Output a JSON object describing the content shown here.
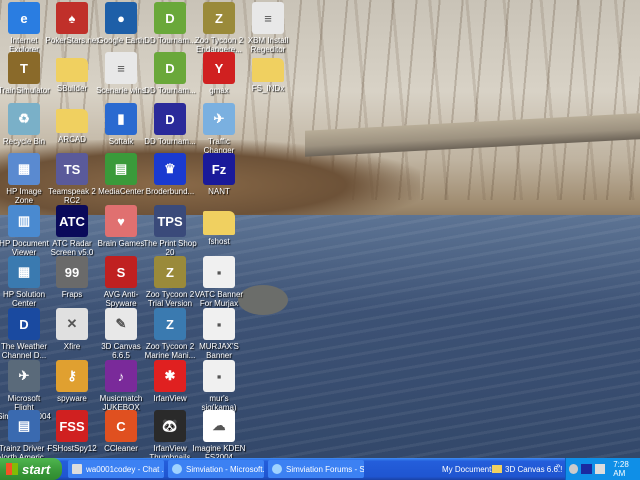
{
  "desktop": {
    "rows": [
      [
        {
          "label": "Internet Explorer",
          "icon": "internet-explorer-icon",
          "color": "#2a7de1",
          "glyph": "e"
        },
        {
          "label": "PokerStars.net",
          "icon": "pokerstars-icon",
          "color": "#c0302a",
          "glyph": "♠"
        },
        {
          "label": "Google Earth",
          "icon": "google-earth-icon",
          "color": "#1e5fa8",
          "glyph": "●"
        },
        {
          "label": "DD Tournam...",
          "icon": "dd-tournament-icon",
          "color": "#6aa83a",
          "glyph": "D"
        },
        {
          "label": "Zoo Tycoon 2 Endangere...",
          "icon": "zoo-tycoon-icon",
          "color": "#9a8a3a",
          "glyph": "Z"
        },
        {
          "label": "XBM Install Regeditor",
          "icon": "document-icon",
          "color": "#e8e8e8",
          "glyph": "≡"
        }
      ],
      [
        {
          "label": "TrainSimulator",
          "icon": "train-simulator-icon",
          "color": "#8a6a2a",
          "glyph": "T"
        },
        {
          "label": "SBuilder",
          "icon": "folder-icon",
          "color": "#f0d060",
          "glyph": ""
        },
        {
          "label": "Scenarie wins",
          "icon": "document-icon",
          "color": "#e8e8e8",
          "glyph": "≡"
        },
        {
          "label": "DD Tournam...",
          "icon": "dd-tournament-icon",
          "color": "#6aa83a",
          "glyph": "D"
        },
        {
          "label": "gmax",
          "icon": "gmax-icon",
          "color": "#d02020",
          "glyph": "Y"
        },
        {
          "label": "FS_INDx",
          "icon": "folder-icon",
          "color": "#f0d060",
          "glyph": ""
        }
      ],
      [
        {
          "label": "Recycle Bin",
          "icon": "recycle-bin-icon",
          "color": "#7ab0c8",
          "glyph": "♻"
        },
        {
          "label": "ARCAD",
          "icon": "folder-icon",
          "color": "#f0d060",
          "glyph": ""
        },
        {
          "label": "Softalk",
          "icon": "softalk-icon",
          "color": "#2a6ad0",
          "glyph": "▮"
        },
        {
          "label": "DD Tournam...",
          "icon": "dd-tournament-icon",
          "color": "#2a2a9a",
          "glyph": "D"
        },
        {
          "label": "Traffic Changer",
          "icon": "traffic-changer-icon",
          "color": "#7ab0e0",
          "glyph": "✈"
        }
      ],
      [
        {
          "label": "HP Image Zone",
          "icon": "hp-image-zone-icon",
          "color": "#5a8ad0",
          "glyph": "▦"
        },
        {
          "label": "Teamspeak 2 RC2",
          "icon": "teamspeak-icon",
          "color": "#5a5a9a",
          "glyph": "TS"
        },
        {
          "label": "MediaCenter",
          "icon": "media-center-icon",
          "color": "#3a9a3a",
          "glyph": "▤"
        },
        {
          "label": "Broderbund...",
          "icon": "broderbund-icon",
          "color": "#1a3ad0",
          "glyph": "♛"
        },
        {
          "label": "NANT",
          "icon": "filezilla-icon",
          "color": "#1a1a9a",
          "glyph": "Fz"
        }
      ],
      [
        {
          "label": "HP Document Viewer",
          "icon": "hp-document-viewer-icon",
          "color": "#4a8ad0",
          "glyph": "▥"
        },
        {
          "label": "ATC Radar Screen v5.0",
          "icon": "atc-radar-icon",
          "color": "#0a0a5a",
          "glyph": "ATC"
        },
        {
          "label": "Brain Games",
          "icon": "brain-games-icon",
          "color": "#e07070",
          "glyph": "♥"
        },
        {
          "label": "The Print Shop 20",
          "icon": "print-shop-icon",
          "color": "#3a4a7a",
          "glyph": "TPS"
        },
        {
          "label": "fshost",
          "icon": "folder-icon",
          "color": "#f0d060",
          "glyph": ""
        }
      ],
      [
        {
          "label": "HP Solution Center",
          "icon": "hp-solution-center-icon",
          "color": "#3a7ab0",
          "glyph": "▦"
        },
        {
          "label": "Fraps",
          "icon": "fraps-icon",
          "color": "#6a6a6a",
          "glyph": "99"
        },
        {
          "label": "AVG Anti-Spyware",
          "icon": "avg-antispyware-icon",
          "color": "#c02020",
          "glyph": "S"
        },
        {
          "label": "Zoo Tycoon 2 Trial Version",
          "icon": "zoo-tycoon-icon",
          "color": "#9a8a3a",
          "glyph": "Z"
        },
        {
          "label": "VATC Banner For Murjax",
          "icon": "image-file-icon",
          "color": "#f0f0f0",
          "glyph": "▪"
        }
      ],
      [
        {
          "label": "The Weather Channel D...",
          "icon": "weather-channel-icon",
          "color": "#1a4aa0",
          "glyph": "D"
        },
        {
          "label": "Xfire",
          "icon": "xfire-icon",
          "color": "#e0e0e0",
          "glyph": "✕"
        },
        {
          "label": "3D Canvas 6.6.5",
          "icon": "3d-canvas-icon",
          "color": "#e8e8e8",
          "glyph": "✎"
        },
        {
          "label": "Zoo Tycoon 2 Marine Mani...",
          "icon": "zoo-tycoon-icon",
          "color": "#3a7ab0",
          "glyph": "Z"
        },
        {
          "label": "MURJAX'S Banner",
          "icon": "image-file-icon",
          "color": "#f0f0f0",
          "glyph": "▪"
        }
      ],
      [
        {
          "label": "Microsoft Flight Simulator 2004",
          "icon": "flight-simulator-icon",
          "color": "#5a6a7a",
          "glyph": "✈"
        },
        {
          "label": "spyware",
          "icon": "spyware-icon",
          "color": "#e0a030",
          "glyph": "⚷"
        },
        {
          "label": "Musicmatch JUKEBOX",
          "icon": "musicmatch-icon",
          "color": "#7a2a9a",
          "glyph": "♪"
        },
        {
          "label": "IrfanView",
          "icon": "irfanview-icon",
          "color": "#e02020",
          "glyph": "✱"
        },
        {
          "label": "mur's sig(kama)",
          "icon": "image-file-icon",
          "color": "#f0f0f0",
          "glyph": "▪"
        }
      ],
      [
        {
          "label": "Trainz Driver - North Americ...",
          "icon": "trainz-icon",
          "color": "#3a6ab0",
          "glyph": "▤"
        },
        {
          "label": "FSHostSpy12",
          "icon": "fshostspy-icon",
          "color": "#d02020",
          "glyph": "FSS"
        },
        {
          "label": "CCleaner",
          "icon": "ccleaner-icon",
          "color": "#e05020",
          "glyph": "C"
        },
        {
          "label": "IrfanView Thumbnails",
          "icon": "irfanview-thumbnails-icon",
          "color": "#2a2a2a",
          "glyph": "🐼"
        },
        {
          "label": "Imagine KDEN FS2004",
          "icon": "cloud-icon",
          "color": "#ffffff",
          "glyph": "☁"
        }
      ]
    ]
  },
  "taskbar": {
    "start_label": "start",
    "tasks": [
      {
        "label": "wa0001codey - Chat ..."
      },
      {
        "label": "Simviation - Microsoft..."
      },
      {
        "label": "Simviation Forums - S..."
      }
    ],
    "toolbar": {
      "my_documents": "My Documents",
      "canvas": "3D Canvas 6.6.!",
      "chevron": "»"
    },
    "clock": "7:28 AM"
  }
}
